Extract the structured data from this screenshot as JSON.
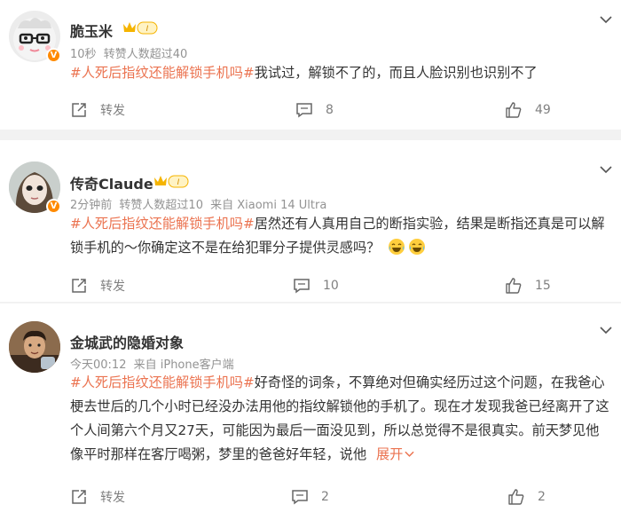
{
  "colors": {
    "topic": "#eb7350",
    "meta": "#939393",
    "divider": "#f2f2f2",
    "vip_gold": "#f5b400"
  },
  "posts": [
    {
      "username": "脆玉米",
      "level_badge": "I",
      "meta": [
        "10秒",
        "转赞人数超过40"
      ],
      "topic": "#人死后指纹还能解锁手机吗#",
      "body": "我试过，解锁不了的，而且人脸识别也识别不了",
      "expand": "",
      "actions": {
        "repost": "转发",
        "comments": "8",
        "likes": "49"
      }
    },
    {
      "username": "传奇Claude",
      "level_badge": "I",
      "meta": [
        "2分钟前",
        "转赞人数超过10",
        "来自 Xiaomi 14 Ultra"
      ],
      "topic": "#人死后指纹还能解锁手机吗#",
      "body": "居然还有人真用自己的断指实验，结果是断指还真是可以解锁手机的～你确定这不是在给犯罪分子提供灵感吗？",
      "expand": "",
      "actions": {
        "repost": "转发",
        "comments": "10",
        "likes": "15"
      }
    },
    {
      "username": "金城武的隐婚对象",
      "level_badge": "",
      "meta": [
        "今天00:12",
        "来自 iPhone客户端"
      ],
      "topic": "#人死后指纹还能解锁手机吗#",
      "body": "好奇怪的词条，不算绝对但确实经历过这个问题，在我爸心梗去世后的几个小时已经没办法用他的指纹解锁他的手机了。现在才发现我爸已经离开了这个人间第六个月又27天，可能因为最后一面没见到，所以总觉得不是很真实。前天梦见他像平时那样在客厅喝粥，梦里的爸爸好年轻，说他",
      "expand": "展开",
      "actions": {
        "repost": "转发",
        "comments": "2",
        "likes": "2"
      }
    }
  ]
}
